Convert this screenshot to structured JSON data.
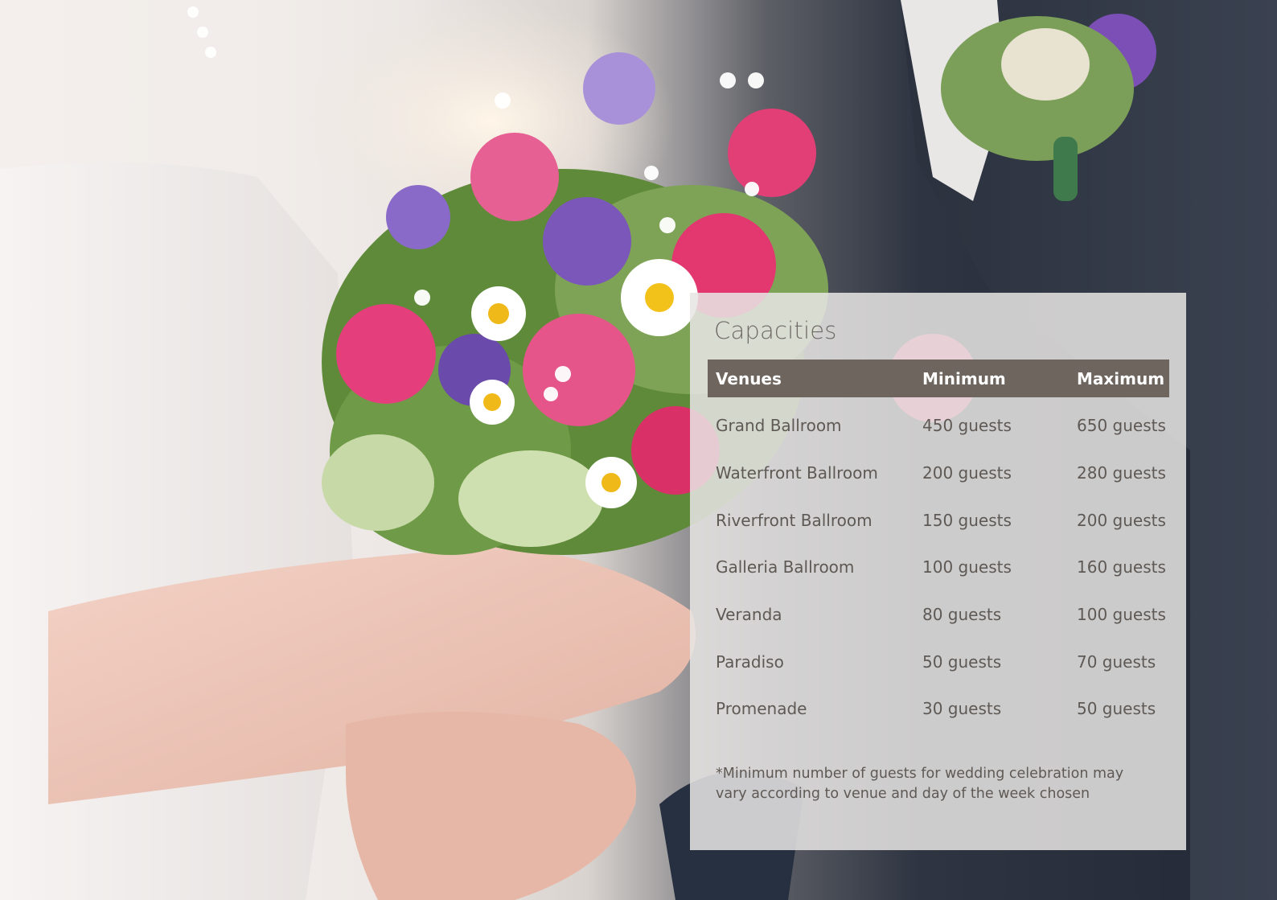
{
  "panel": {
    "title": "Capacities",
    "columns": [
      "Venues",
      "Minimum",
      "Maximum"
    ],
    "rows": [
      {
        "venue": "Grand Ballroom",
        "min": "450 guests",
        "max": "650 guests"
      },
      {
        "venue": "Waterfront Ballroom",
        "min": "200 guests",
        "max": "280 guests"
      },
      {
        "venue": "Riverfront Ballroom",
        "min": "150 guests",
        "max": "200 guests"
      },
      {
        "venue": "Galleria Ballroom",
        "min": "100 guests",
        "max": "160 guests"
      },
      {
        "venue": "Veranda",
        "min": "80 guests",
        "max": "100 guests"
      },
      {
        "venue": "Paradiso",
        "min": "50 guests",
        "max": "70 guests"
      },
      {
        "venue": "Promenade",
        "min": "30 guests",
        "max": "50 guests"
      }
    ],
    "note_lines": [
      "*Minimum number of guests for wedding celebration may",
      "vary according to venue and day of the week chosen"
    ]
  },
  "colors": {
    "header_bg": "#6d655e",
    "text": "#5e5954",
    "title": "#6f6a66",
    "panel_bg": "#e8e5e4"
  }
}
